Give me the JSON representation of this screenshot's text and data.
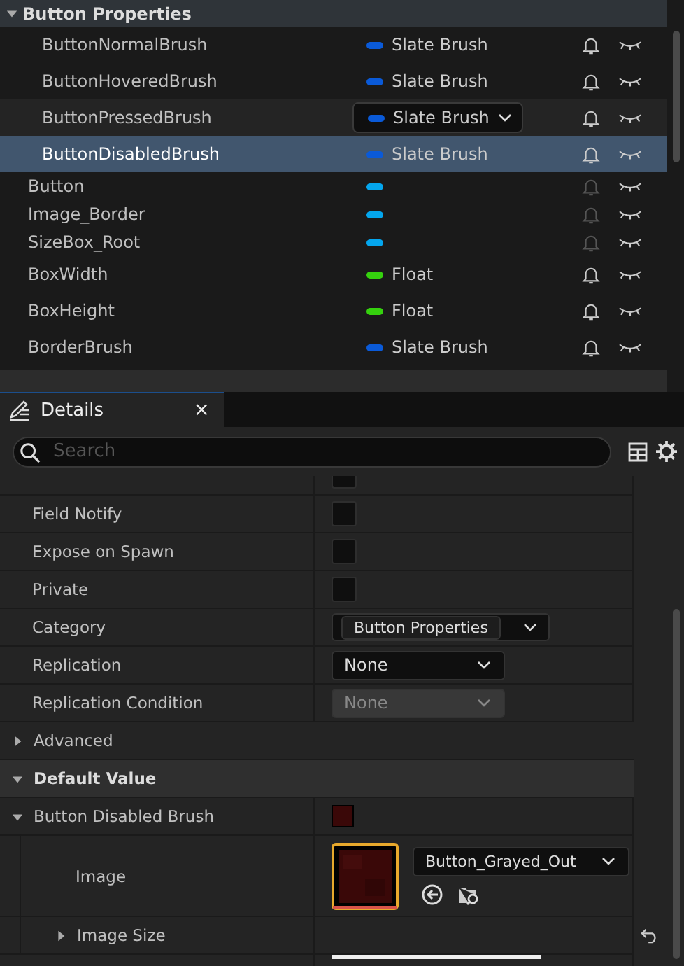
{
  "variables": {
    "category": {
      "label": "Button Properties",
      "expanded": true,
      "children": [
        {
          "name": "ButtonNormalBrush",
          "color": "#0a5ad8",
          "type": "Slate Brush",
          "selected": false,
          "editing": false,
          "notify_disabled": false
        },
        {
          "name": "ButtonHoveredBrush",
          "color": "#0a5ad8",
          "type": "Slate Brush",
          "selected": false,
          "editing": false,
          "notify_disabled": false
        },
        {
          "name": "ButtonPressedBrush",
          "color": "#0a5ad8",
          "type": "Slate Brush",
          "selected": false,
          "editing": true,
          "notify_disabled": false
        },
        {
          "name": "ButtonDisabledBrush",
          "color": "#0a5ad8",
          "type": "Slate Brush",
          "selected": true,
          "editing": false,
          "notify_disabled": false
        }
      ]
    },
    "items": [
      {
        "name": "Button",
        "color": "#04a6ee",
        "selected": false,
        "notify_disabled": true
      },
      {
        "name": "Image_Border",
        "color": "#04a6ee",
        "selected": false,
        "notify_disabled": true
      },
      {
        "name": "SizeBox_Root",
        "color": "#04a6ee",
        "selected": false,
        "notify_disabled": true
      },
      {
        "name": "BoxWidth",
        "color": "#35d10e",
        "type": "Float",
        "selected": false,
        "notify_disabled": false
      },
      {
        "name": "BoxHeight",
        "color": "#35d10e",
        "type": "Float",
        "selected": false,
        "notify_disabled": false
      },
      {
        "name": "BorderBrush",
        "color": "#0a5ad8",
        "type": "Slate Brush",
        "selected": false,
        "notify_disabled": false
      }
    ]
  },
  "details": {
    "tab": {
      "title": "Details",
      "close": "×"
    },
    "search": {
      "placeholder": "Search"
    },
    "rows": [
      {
        "kind": "checkbox",
        "label": "",
        "checked": false,
        "partial": true
      },
      {
        "kind": "checkbox",
        "label": "Field Notify",
        "checked": false
      },
      {
        "kind": "checkbox",
        "label": "Expose on Spawn",
        "checked": false
      },
      {
        "kind": "checkbox",
        "label": "Private",
        "checked": false
      },
      {
        "kind": "category",
        "label": "Category",
        "value": "Button Properties"
      },
      {
        "kind": "combo",
        "label": "Replication",
        "value": "None",
        "disabled": false
      },
      {
        "kind": "combo",
        "label": "Replication Condition",
        "value": "None",
        "disabled": true
      },
      {
        "kind": "group",
        "label": "Advanced",
        "expanded": false
      },
      {
        "kind": "section",
        "label": "Default Value",
        "expanded": true
      },
      {
        "kind": "struct",
        "label": "Button Disabled Brush",
        "expanded": true
      },
      {
        "label": "Image",
        "value": "Button_Grayed_Out"
      },
      {
        "kind": "subgroup",
        "label": "Image Size",
        "expanded": false
      }
    ]
  }
}
